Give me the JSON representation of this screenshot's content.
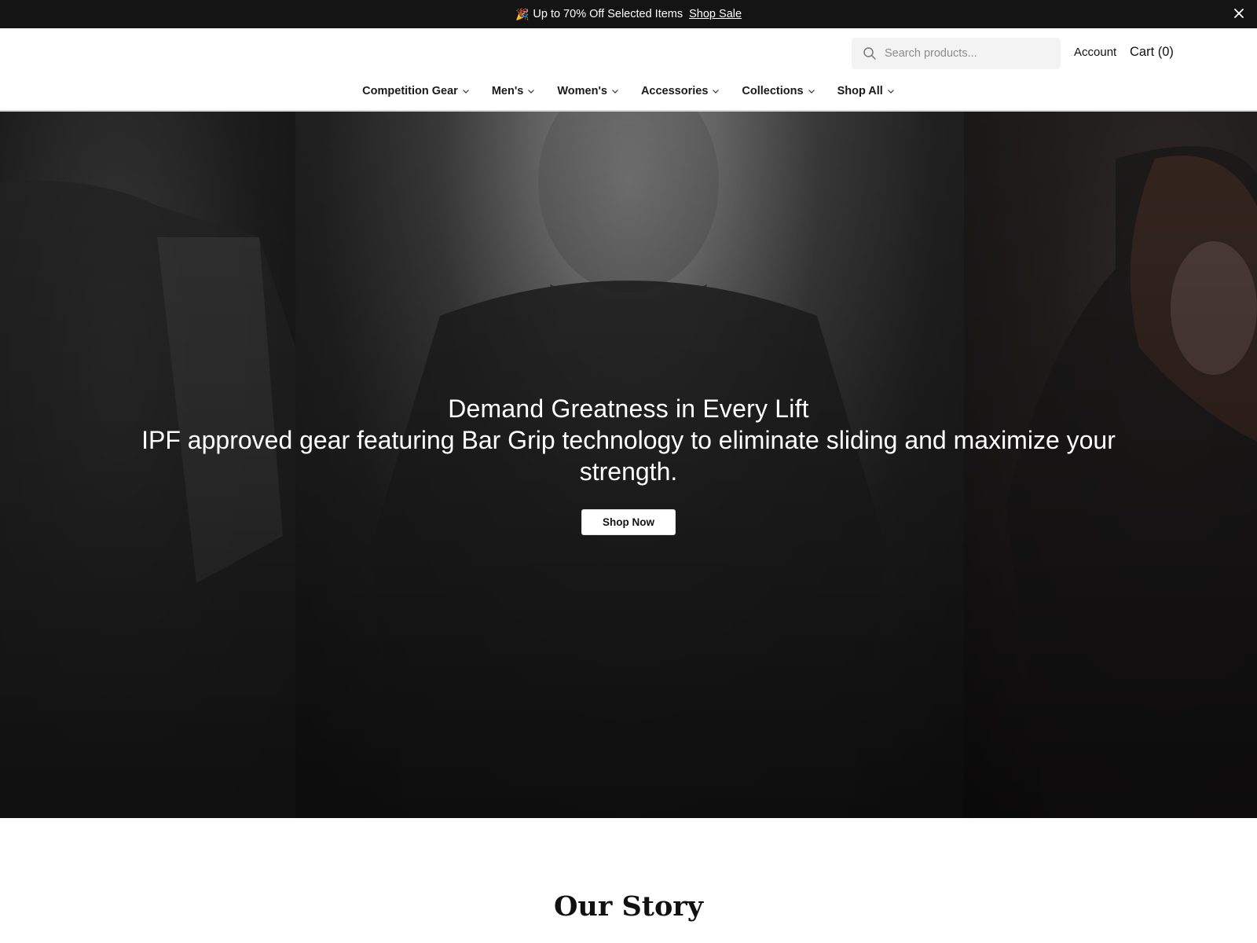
{
  "announcement": {
    "emoji": "🎉",
    "text": "Up to 70% Off Selected Items",
    "link_label": "Shop Sale"
  },
  "header": {
    "search_placeholder": "Search products...",
    "account_label": "Account",
    "cart_label": "Cart (0)"
  },
  "nav": {
    "items": [
      {
        "label": "Competition Gear"
      },
      {
        "label": "Men's"
      },
      {
        "label": "Women's"
      },
      {
        "label": "Accessories"
      },
      {
        "label": "Collections"
      },
      {
        "label": "Shop All"
      }
    ]
  },
  "hero": {
    "title": "Demand Greatness in Every Lift",
    "subtitle": "IPF approved gear featuring Bar Grip technology to eliminate sliding and maximize your strength.",
    "button_label": "Shop Now"
  },
  "story": {
    "title": "Our Story"
  },
  "colors": {
    "announcement_bg": "#141414",
    "nav_text": "#1a1a1a",
    "hero_button_bg": "#ffffff"
  }
}
